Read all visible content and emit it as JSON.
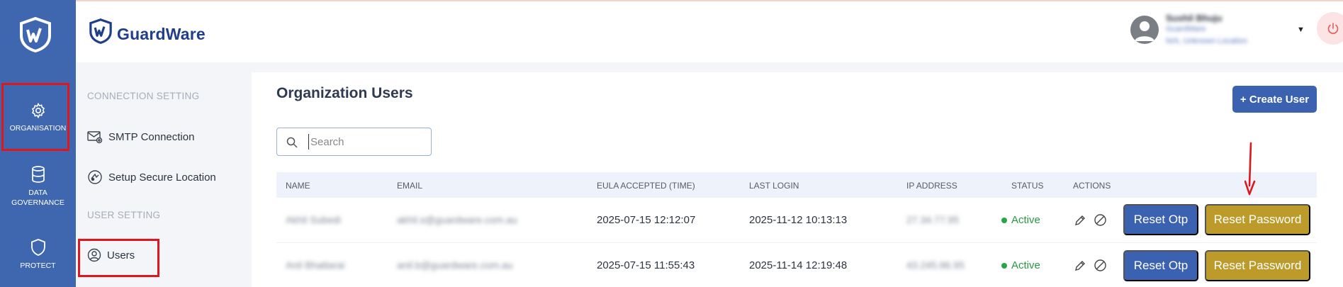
{
  "brand": {
    "name": "GuardWare"
  },
  "rail": {
    "items": [
      {
        "label": "ORGANISATION",
        "icon": "gear-icon"
      },
      {
        "label_line1": "DATA",
        "label_line2": "GOVERNANCE",
        "icon": "database-icon"
      },
      {
        "label": "PROTECT",
        "icon": "shield-icon"
      }
    ]
  },
  "sidebar": {
    "sections": [
      {
        "title": "CONNECTION SETTING",
        "items": [
          {
            "label": "SMTP Connection",
            "icon": "mail-settings-icon"
          },
          {
            "label": "Setup Secure Location",
            "icon": "secure-location-icon"
          }
        ]
      },
      {
        "title": "USER SETTING",
        "items": [
          {
            "label": "Users",
            "icon": "user-circle-icon"
          }
        ]
      }
    ]
  },
  "header": {
    "user": {
      "name": "Sushil Bhuju",
      "line2": "GuardWare",
      "line3": "N/A, Unknown Location"
    },
    "icons": [
      "avatar-icon",
      "caret-down-icon",
      "power-icon"
    ]
  },
  "main": {
    "title": "Organization Users",
    "create_label": "+ Create User",
    "search": {
      "placeholder": "Search",
      "value": ""
    },
    "columns": [
      "NAME",
      "EMAIL",
      "EULA ACCEPTED (TIME)",
      "LAST LOGIN",
      "IP ADDRESS",
      "STATUS",
      "ACTIONS"
    ],
    "rows": [
      {
        "name": "Akhil Subedi",
        "email": "akhil.s@guardware.com.au",
        "eula": "2025-07-15 12:12:07",
        "last_login": "2025-11-12 10:13:13",
        "ip": "27.34.77.95",
        "status": "Active",
        "otp_label": "Reset Otp",
        "reset_label": "Reset Password"
      },
      {
        "name": "Anil Bhattarai",
        "email": "anil.b@guardware.com.au",
        "eula": "2025-07-15 11:55:43",
        "last_login": "2025-11-14 12:19:48",
        "ip": "43.245.86.95",
        "status": "Active",
        "otp_label": "Reset Otp",
        "reset_label": "Reset Password"
      }
    ]
  },
  "colors": {
    "rail": "#3f67b0",
    "primary": "#3b62b0",
    "reset": "#bc9b2b",
    "active": "#259b40",
    "highlight": "#e0161d"
  }
}
